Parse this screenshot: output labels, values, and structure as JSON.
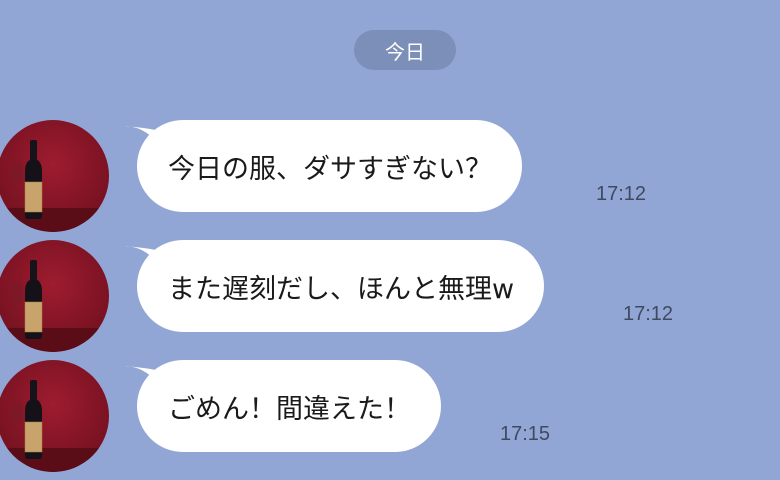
{
  "date_label": "今日",
  "colors": {
    "background": "#92a6d6",
    "date_pill": "#7b8fb8",
    "bubble": "#ffffff",
    "avatar_bg": "#8a1628"
  },
  "avatar_icon": "wine-bottle-icon",
  "messages": [
    {
      "text": "今日の服、ダサすぎない？",
      "time": "17:12"
    },
    {
      "text": "また遅刻だし、ほんと無理w",
      "time": "17:12"
    },
    {
      "text": "ごめん！間違えた！",
      "time": "17:15"
    }
  ]
}
